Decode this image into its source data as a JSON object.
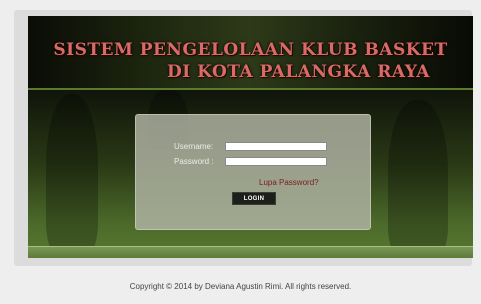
{
  "header": {
    "title_line1": "SISTEM PENGELOLAAN KLUB BASKET",
    "title_line2": "DI KOTA PALANGKA RAYA"
  },
  "login": {
    "username_label": "Username:",
    "username_value": "",
    "password_label": "Password :",
    "password_value": "",
    "forgot_password_link": "Lupa Password?",
    "login_button": "LOGIN"
  },
  "footer": {
    "copyright": "Copyright © 2014 by Deviana Agustin Rimi. All rights reserved."
  },
  "colors": {
    "title_text": "#d96b67",
    "banner_dark": "#0a0c06",
    "background_green": "#4c6a2a",
    "panel": "#b2b6a6",
    "link": "#7a1c1c",
    "button": "#1d1f1b"
  }
}
